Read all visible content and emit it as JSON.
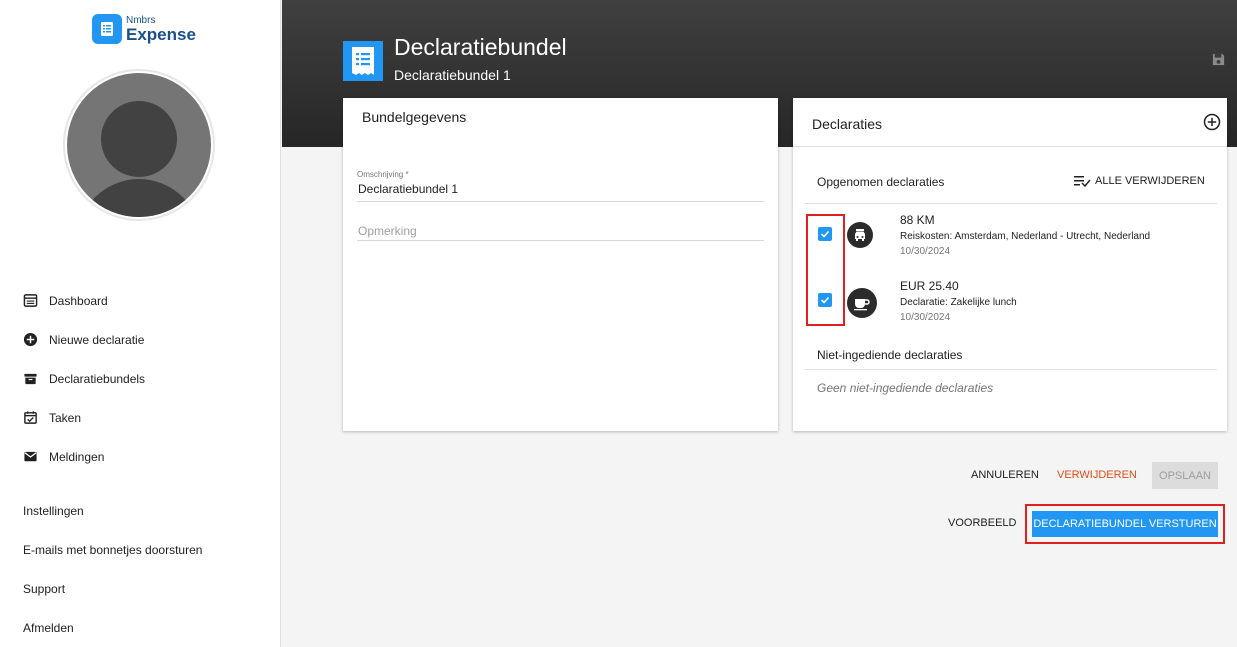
{
  "logo": {
    "small": "Nmbrs",
    "big": "Expense"
  },
  "sidebar": {
    "nav": [
      {
        "label": "Dashboard",
        "icon": "dashboard-icon"
      },
      {
        "label": "Nieuwe declaratie",
        "icon": "add-circle-icon"
      },
      {
        "label": "Declaratiebundels",
        "icon": "archive-icon"
      },
      {
        "label": "Taken",
        "icon": "task-calendar-icon"
      },
      {
        "label": "Meldingen",
        "icon": "mail-icon"
      }
    ],
    "links": [
      {
        "label": "Instellingen"
      },
      {
        "label": "E-mails met bonnetjes doorsturen"
      },
      {
        "label": "Support"
      },
      {
        "label": "Afmelden"
      }
    ]
  },
  "header": {
    "title": "Declaratiebundel",
    "subtitle": "Declaratiebundel 1"
  },
  "bundle_details": {
    "title": "Bundelgegevens",
    "description_label": "Omschrijving *",
    "description_value": "Declaratiebundel 1",
    "remark_placeholder": "Opmerking"
  },
  "declarations": {
    "title": "Declaraties",
    "included_label": "Opgenomen declaraties",
    "remove_all_label": "ALLE VERWIJDEREN",
    "items": [
      {
        "amount": "88 KM",
        "description": "Reiskosten: Amsterdam, Nederland - Utrecht, Nederland",
        "date": "10/30/2024",
        "icon": "car-icon",
        "checked": true
      },
      {
        "amount": "EUR 25.40",
        "description": "Declaratie: Zakelijke lunch",
        "date": "10/30/2024",
        "icon": "coffee-icon",
        "checked": true
      }
    ],
    "not_submitted_label": "Niet-ingediende declaraties",
    "not_submitted_empty": "Geen niet-ingediende declaraties"
  },
  "actions": {
    "cancel": "ANNULEREN",
    "delete": "VERWIJDEREN",
    "save": "OPSLAAN",
    "preview": "VOORBEELD",
    "send": "DECLARATIEBUNDEL VERSTUREN"
  },
  "colors": {
    "accent": "#2196f3",
    "danger": "#e64a19",
    "highlight": "#e02020",
    "header_dark": "#2e2e2e"
  }
}
